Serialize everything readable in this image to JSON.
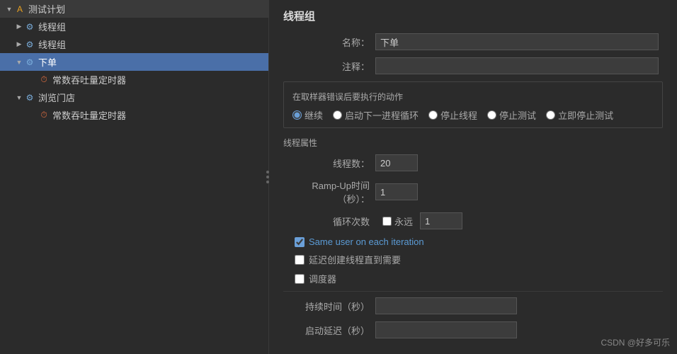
{
  "leftPanel": {
    "items": [
      {
        "id": "test-plan",
        "label": "测试计划",
        "icon": "A",
        "iconClass": "icon-test",
        "indent": 0,
        "arrow": "open",
        "selected": false
      },
      {
        "id": "thread-group-1",
        "label": "线程组",
        "icon": "⚙",
        "iconClass": "icon-gear",
        "indent": 1,
        "arrow": "closed",
        "selected": false
      },
      {
        "id": "thread-group-2",
        "label": "线程组",
        "icon": "⚙",
        "iconClass": "icon-gear",
        "indent": 1,
        "arrow": "closed",
        "selected": false
      },
      {
        "id": "order",
        "label": "下单",
        "icon": "⚙",
        "iconClass": "icon-gear",
        "indent": 1,
        "arrow": "open",
        "selected": true
      },
      {
        "id": "timer-1",
        "label": "常数吞吐量定时器",
        "icon": "⏱",
        "iconClass": "icon-timer",
        "indent": 2,
        "arrow": "empty",
        "selected": false
      },
      {
        "id": "browse-shop",
        "label": "浏览门店",
        "icon": "⚙",
        "iconClass": "icon-gear",
        "indent": 1,
        "arrow": "open",
        "selected": false
      },
      {
        "id": "timer-2",
        "label": "常数吞吐量定时器",
        "icon": "⏱",
        "iconClass": "icon-timer",
        "indent": 2,
        "arrow": "empty",
        "selected": false
      }
    ]
  },
  "rightPanel": {
    "title": "线程组",
    "fields": {
      "nameLabel": "名称：",
      "nameValue": "下单",
      "commentLabel": "注释：",
      "commentValue": "",
      "errorActionLabel": "在取样器错误后要执行的动作",
      "radioOptions": [
        {
          "id": "continue",
          "label": "继续",
          "checked": true
        },
        {
          "id": "start-next",
          "label": "启动下一进程循环",
          "checked": false
        },
        {
          "id": "stop-thread",
          "label": "停止线程",
          "checked": false
        },
        {
          "id": "stop-test",
          "label": "停止测试",
          "checked": false
        },
        {
          "id": "stop-test-now",
          "label": "立即停止测试",
          "checked": false
        }
      ],
      "threadPropsLabel": "线程属性",
      "threadCountLabel": "线程数：",
      "threadCountValue": "20",
      "rampUpLabel": "Ramp-Up时间（秒）：",
      "rampUpValue": "1",
      "loopCountLabel": "循环次数",
      "foreverLabel": "永远",
      "foreverChecked": false,
      "loopCountValue": "1",
      "checkboxes": [
        {
          "id": "same-user",
          "label": "Same user on each iteration",
          "checked": true,
          "blue": true
        },
        {
          "id": "delay-create",
          "label": "延迟创建线程直到需要",
          "checked": false,
          "blue": false
        },
        {
          "id": "scheduler",
          "label": "调度器",
          "checked": false,
          "blue": false
        }
      ],
      "durationLabel": "持续时间（秒）",
      "durationValue": "",
      "startupDelayLabel": "启动延迟（秒）",
      "startupDelayValue": ""
    }
  },
  "watermark": "CSDN @好多可乐"
}
